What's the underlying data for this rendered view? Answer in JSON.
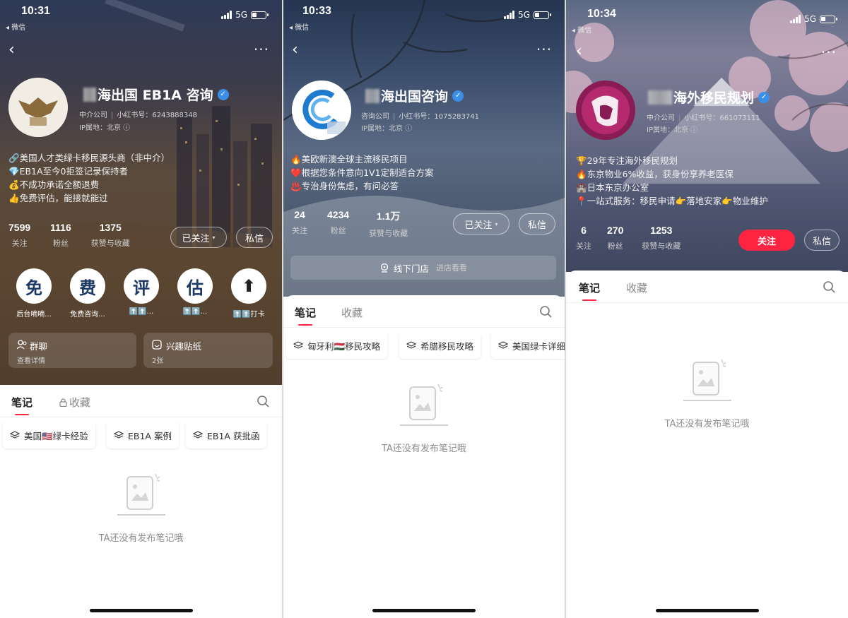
{
  "colors": {
    "accent_red": "#ff2442",
    "verified_blue": "#3b8fe8"
  },
  "phones": [
    {
      "status": {
        "time": "10:31",
        "back_app": "◂ 微信",
        "network": "5G"
      },
      "profile": {
        "name": "海出国 EB1A 咨询",
        "meta_type": "中介公司",
        "meta_id": "小红书号：6243888348",
        "ip": "IP属地：北京",
        "bio": [
          "🔗美国人才类绿卡移民源头商（非中介）",
          "💎EB1A至今0拒签记录保持者",
          "💰不成功承诺全额退费",
          "👍免费评估，能接就能过"
        ],
        "stats": [
          {
            "num": "7599",
            "label": "关注"
          },
          {
            "num": "1116",
            "label": "粉丝"
          },
          {
            "num": "1375",
            "label": "获赞与收藏"
          }
        ],
        "follow_label": "已关注",
        "message_label": "私信"
      },
      "circles": [
        {
          "char": "免",
          "label": "后台嘀嘀..."
        },
        {
          "char": "费",
          "label": "免费咨询..."
        },
        {
          "char": "评",
          "label": "⬆️⬆️..."
        },
        {
          "char": "估",
          "label": "⬆️⬆️..."
        },
        {
          "char": "⬆",
          "label": "⬆️⬆️打卡"
        }
      ],
      "panels": [
        {
          "title": "群聊",
          "sub": "查看详情",
          "icon": "group-icon"
        },
        {
          "title": "兴趣贴纸",
          "sub": "2张",
          "icon": "sticker-icon"
        }
      ],
      "tabs": [
        "笔记",
        "收藏"
      ],
      "chips": [
        "美国🇺🇸绿卡经验",
        "EB1A 案例",
        "EB1A 获批函"
      ],
      "empty_text": "TA还没有发布笔记哦"
    },
    {
      "status": {
        "time": "10:33",
        "back_app": "◂ 微信",
        "network": "5G"
      },
      "profile": {
        "name": "海出国咨询",
        "meta_type": "咨询公司",
        "meta_id": "小红书号：1075283741",
        "ip": "IP属地：北京",
        "bio": [
          "🔥美欧新澳全球主流移民项目",
          "❤️根据您条件意向1V1定制适合方案",
          "♨️专治身份焦虑，有问必答"
        ],
        "stats": [
          {
            "num": "24",
            "label": "关注"
          },
          {
            "num": "4234",
            "label": "粉丝"
          },
          {
            "num": "1.1万",
            "label": "获赞与收藏"
          }
        ],
        "follow_label": "已关注",
        "message_label": "私信"
      },
      "store": {
        "label": "线下门店",
        "sub": "进店看看"
      },
      "tabs": [
        "笔记",
        "收藏"
      ],
      "chips": [
        "匈牙利🇭🇺移民攻略",
        "希腊移民攻略",
        "美国绿卡详细"
      ],
      "empty_text": "TA还没有发布笔记哦"
    },
    {
      "status": {
        "time": "10:34",
        "back_app": "◂ 微信",
        "network": "5G"
      },
      "profile": {
        "name": "海外移民规划",
        "meta_type": "中介公司",
        "meta_id": "小红书号：661073111",
        "ip": "IP属地：北京",
        "bio": [
          "🏆29年专注海外移民规划",
          "🔥东京物业6%收益，获身份享养老医保",
          "🏰日本东京办公室",
          "📍一站式服务：移民申请👉落地安家👉物业维护"
        ],
        "stats": [
          {
            "num": "6",
            "label": "关注"
          },
          {
            "num": "270",
            "label": "粉丝"
          },
          {
            "num": "1253",
            "label": "获赞与收藏"
          }
        ],
        "follow_label": "关注",
        "message_label": "私信"
      },
      "tabs": [
        "笔记",
        "收藏"
      ],
      "empty_text": "TA还没有发布笔记哦"
    }
  ]
}
